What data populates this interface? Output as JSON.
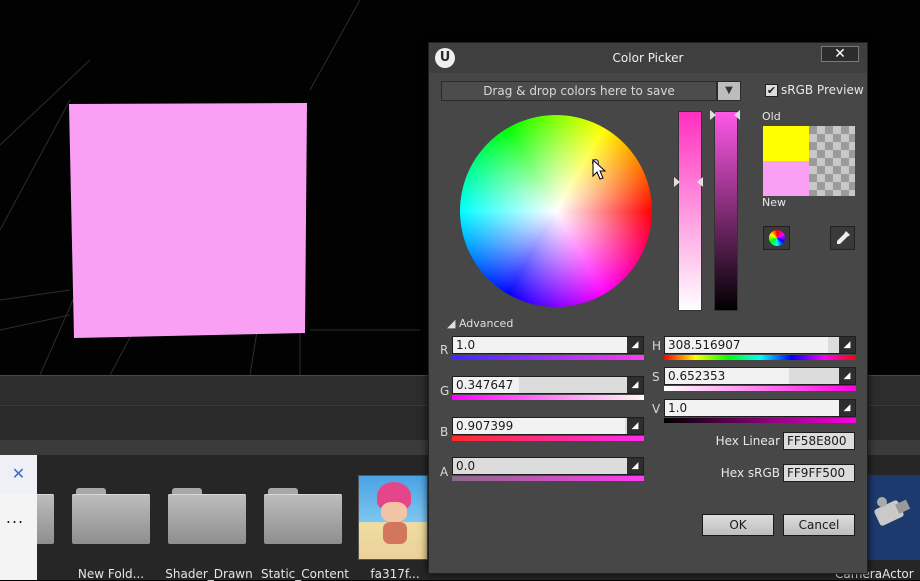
{
  "dialog": {
    "title": "Color Picker",
    "logo": "U",
    "close": "✕",
    "drag_drop": "Drag & drop colors here to save",
    "srgb_preview": "sRGB Preview",
    "old_label": "Old",
    "new_label": "New",
    "old_color": "#ffff00",
    "new_color": "#f9a0f5",
    "advanced": "Advanced",
    "ok": "OK",
    "cancel": "Cancel"
  },
  "channels": {
    "r": {
      "label": "R",
      "value": "1.0",
      "level": 1.0
    },
    "g": {
      "label": "G",
      "value": "0.347647",
      "level": 0.347647
    },
    "b": {
      "label": "B",
      "value": "0.907399",
      "level": 0.907399
    },
    "a": {
      "label": "A",
      "value": "0.0",
      "level": 0.0
    },
    "h": {
      "label": "H",
      "value": "308.516907",
      "level": 0.857
    },
    "s": {
      "label": "S",
      "value": "0.652353",
      "level": 0.652353
    },
    "v": {
      "label": "V",
      "value": "1.0",
      "level": 1.0
    }
  },
  "hex": {
    "linear_label": "Hex Linear",
    "linear_value": "FF58E800",
    "srgb_label": "Hex sRGB",
    "srgb_value": "FF9FF500"
  },
  "content_browser": {
    "folders": [
      "New Fold...",
      "Shader_Drawn",
      "Static_Content"
    ],
    "thumb_label": "fa317f...",
    "camera_label": "CameraActor"
  },
  "side_panel": {
    "close": "✕",
    "more": "..."
  },
  "colors": {
    "viewport_quad": "#f9a0f5",
    "accent": "#f9a0f5"
  }
}
